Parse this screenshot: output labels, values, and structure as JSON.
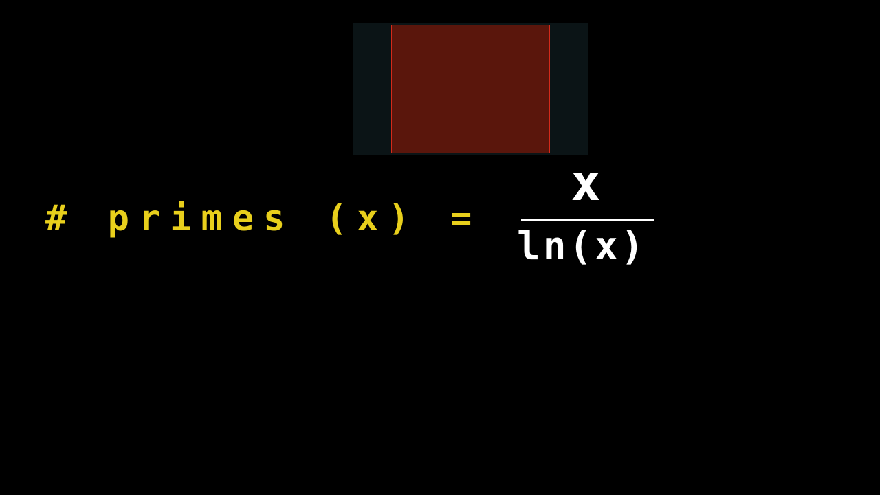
{
  "formula": {
    "left_text": "# primes (x) =",
    "numerator": "x",
    "denominator": "ln(x)",
    "left_color": "#e8cf1c",
    "fraction_color": "#ffffff"
  },
  "video_panel": {
    "background_color": "#0b1416",
    "box_fill_color": "#5a160c",
    "box_border_color": "#d42a1a"
  }
}
